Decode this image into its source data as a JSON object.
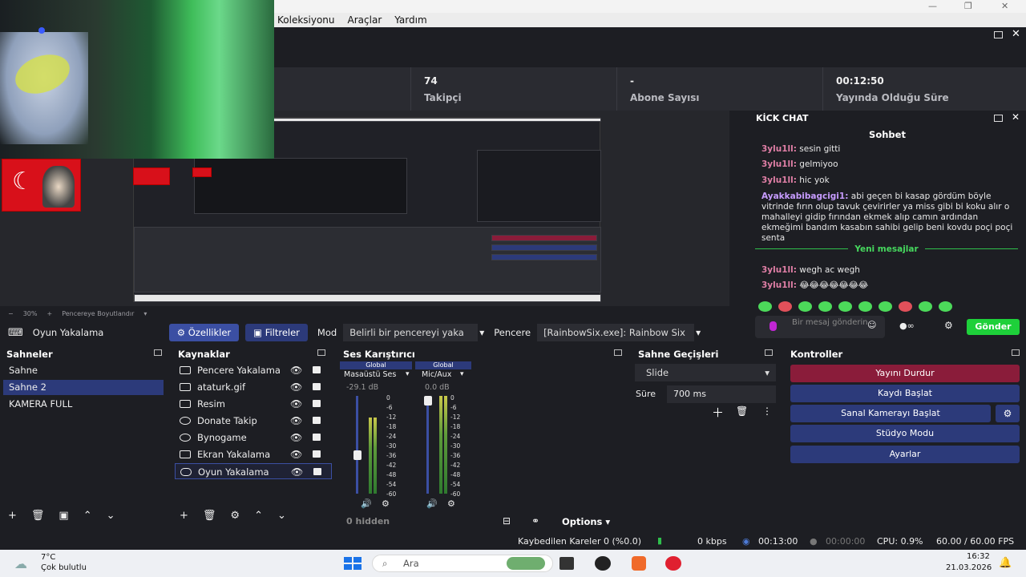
{
  "window": {
    "minimize": "—",
    "restore": "❐",
    "close": "✕"
  },
  "menu": [
    "Koleksiyonu",
    "Araçlar",
    "Yardım"
  ],
  "stats": [
    {
      "value": "74",
      "label": "Takipçi"
    },
    {
      "value": "-",
      "label": "Abone Sayısı"
    },
    {
      "value": "00:12:50",
      "label": "Yayında Olduğu Süre"
    }
  ],
  "preview": {
    "zoom": "30%",
    "fit_label": "Pencereye Boyutlandır",
    "minus": "−",
    "plus": "+"
  },
  "source_toolbar": {
    "source_name": "Oyun Yakalama",
    "properties": "Özellikler",
    "filters": "Filtreler",
    "mode_label": "Mod",
    "mode_value": "Belirli bir pencereyi yaka",
    "window_label": "Pencere",
    "window_value": "[RainbowSix.exe]: Rainbow Six"
  },
  "chat": {
    "title": "KİCK CHAT",
    "header": "Sohbet",
    "messages": [
      {
        "user": "3ylu1ll:",
        "text": " sesin gitti"
      },
      {
        "user": "3ylu1ll:",
        "text": " gelmiyoo"
      },
      {
        "user": "3ylu1ll:",
        "text": " hic yok"
      },
      {
        "user": "Ayakkabibagcigi1:",
        "text": " abi geçen bi kasap gördüm böyle vitrinde fırın olup tavuk çevirirler ya miss gibi bi koku alır o mahalleyi gidip fırından ekmek alıp camın ardından ekmeğimi bandım kasabın sahibi gelip beni kovdu poçi poçi senta"
      }
    ],
    "new_messages": "Yeni mesajlar",
    "new": [
      {
        "user": "3ylu1ll:",
        "text": " wegh ac wegh"
      },
      {
        "user": "3ylu1ll:",
        "text": " 😂😂😂😂😂😂😂"
      }
    ],
    "input_placeholder": "Bir mesaj gönderin",
    "send": "Gönder"
  },
  "scenes": {
    "title": "Sahneler",
    "items": [
      "Sahne",
      "Sahne 2",
      "KAMERA FULL"
    ],
    "selected": 1
  },
  "sources": {
    "title": "Kaynaklar",
    "items": [
      "Pencere Yakalama",
      "ataturk.gif",
      "Resim",
      "Donate Takip",
      "Bynogame",
      "Ekran Yakalama",
      "Oyun Yakalama"
    ],
    "selected": 6
  },
  "mixer": {
    "title": "Ses Karıştırıcı",
    "channels": [
      {
        "badge": "Global",
        "name": "Masaüstü Ses",
        "db": "-29.1 dB",
        "level": 0.78
      },
      {
        "badge": "Global",
        "name": "Mic/Aux",
        "db": "0.0 dB",
        "level": 1.0
      }
    ],
    "ticks": [
      "0",
      "-6",
      "-12",
      "-18",
      "-24",
      "-30",
      "-36",
      "-42",
      "-48",
      "-54",
      "-60"
    ],
    "hidden": "0 hidden",
    "options": "Options"
  },
  "transitions": {
    "title": "Sahne Geçişleri",
    "type": "Slide",
    "duration_label": "Süre",
    "duration": "700 ms"
  },
  "controls": {
    "title": "Kontroller",
    "buttons": [
      "Yayını Durdur",
      "Kaydı Başlat",
      "Sanal Kamerayı Başlat",
      "Stüdyo Modu",
      "Ayarlar"
    ]
  },
  "status": {
    "dropped": "Kaybedilen Kareler 0 (%0.0)",
    "kbps": "0 kbps",
    "stream_time": "00:13:00",
    "rec_time": "00:00:00",
    "cpu": "CPU: 0.9%",
    "fps": "60.00 / 60.00 FPS"
  },
  "taskbar": {
    "temp": "7°C",
    "weather": "Çok bulutlu",
    "search": "Ara",
    "time": "16:32",
    "date": "21.03.2026"
  }
}
